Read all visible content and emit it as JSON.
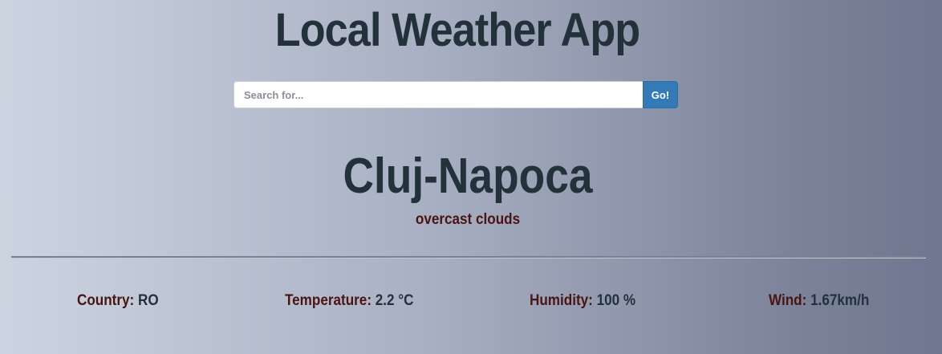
{
  "app": {
    "title": "Local Weather App"
  },
  "search": {
    "placeholder": "Search for...",
    "value": "",
    "button_label": "Go!"
  },
  "location": {
    "city": "Cluj-Napoca",
    "conditions": "overcast clouds"
  },
  "stats": {
    "country": {
      "label": "Country:",
      "value": "RO"
    },
    "temperature": {
      "label": "Temperature:",
      "value": "2.2 °C"
    },
    "humidity": {
      "label": "Humidity:",
      "value": "100 %"
    },
    "wind": {
      "label": "Wind:",
      "value": "1.67km/h"
    }
  },
  "colors": {
    "title_text": "#22313a",
    "label_text": "#4a1412",
    "button_bg": "#337ab7",
    "gradient_start": "#cdd4e1",
    "gradient_end": "#6f7790"
  }
}
